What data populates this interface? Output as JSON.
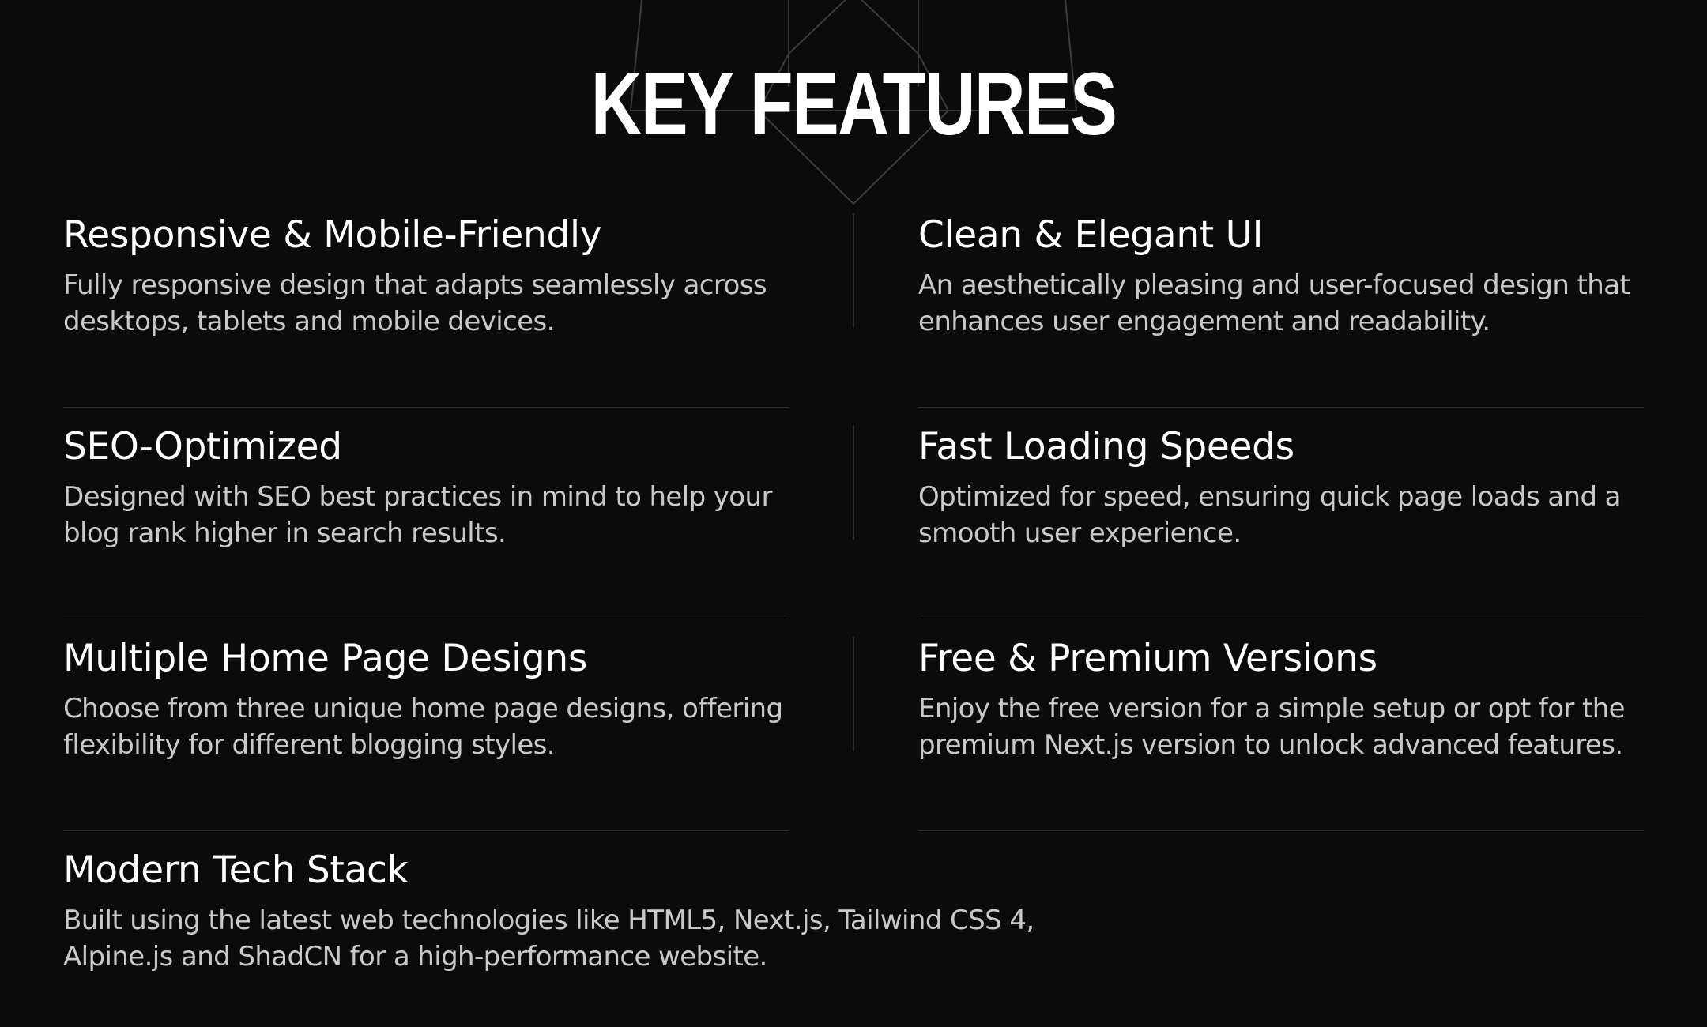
{
  "section": {
    "title": "KEY FEATURES"
  },
  "features": [
    {
      "title": "Responsive & Mobile-Friendly",
      "description": "Fully responsive design that adapts seamlessly across desktops, tablets and mobile devices."
    },
    {
      "title": "Clean & Elegant UI",
      "description": "An aesthetically pleasing and user-focused design that enhances user engagement and readability."
    },
    {
      "title": "SEO-Optimized",
      "description": "Designed with SEO best practices in mind to help your blog rank higher in search results."
    },
    {
      "title": "Fast Loading Speeds",
      "description": "Optimized for speed, ensuring quick page loads and a smooth user experience."
    },
    {
      "title": "Multiple Home Page Designs",
      "description": "Choose from three unique home page designs, offering flexibility for different blogging styles."
    },
    {
      "title": "Free & Premium Versions",
      "description": "Enjoy the free version for a simple setup or opt for the premium Next.js version to unlock advanced features."
    },
    {
      "title": "Modern Tech Stack",
      "description": "Built using the latest web technologies like HTML5, Next.js, Tailwind CSS 4, Alpine.js and ShadCN for a high-performance website."
    }
  ],
  "colors": {
    "background": "#0c0b0c",
    "heading": "#ffffff",
    "body_text": "#c9c9cc",
    "divider": "#2a2a2c"
  }
}
